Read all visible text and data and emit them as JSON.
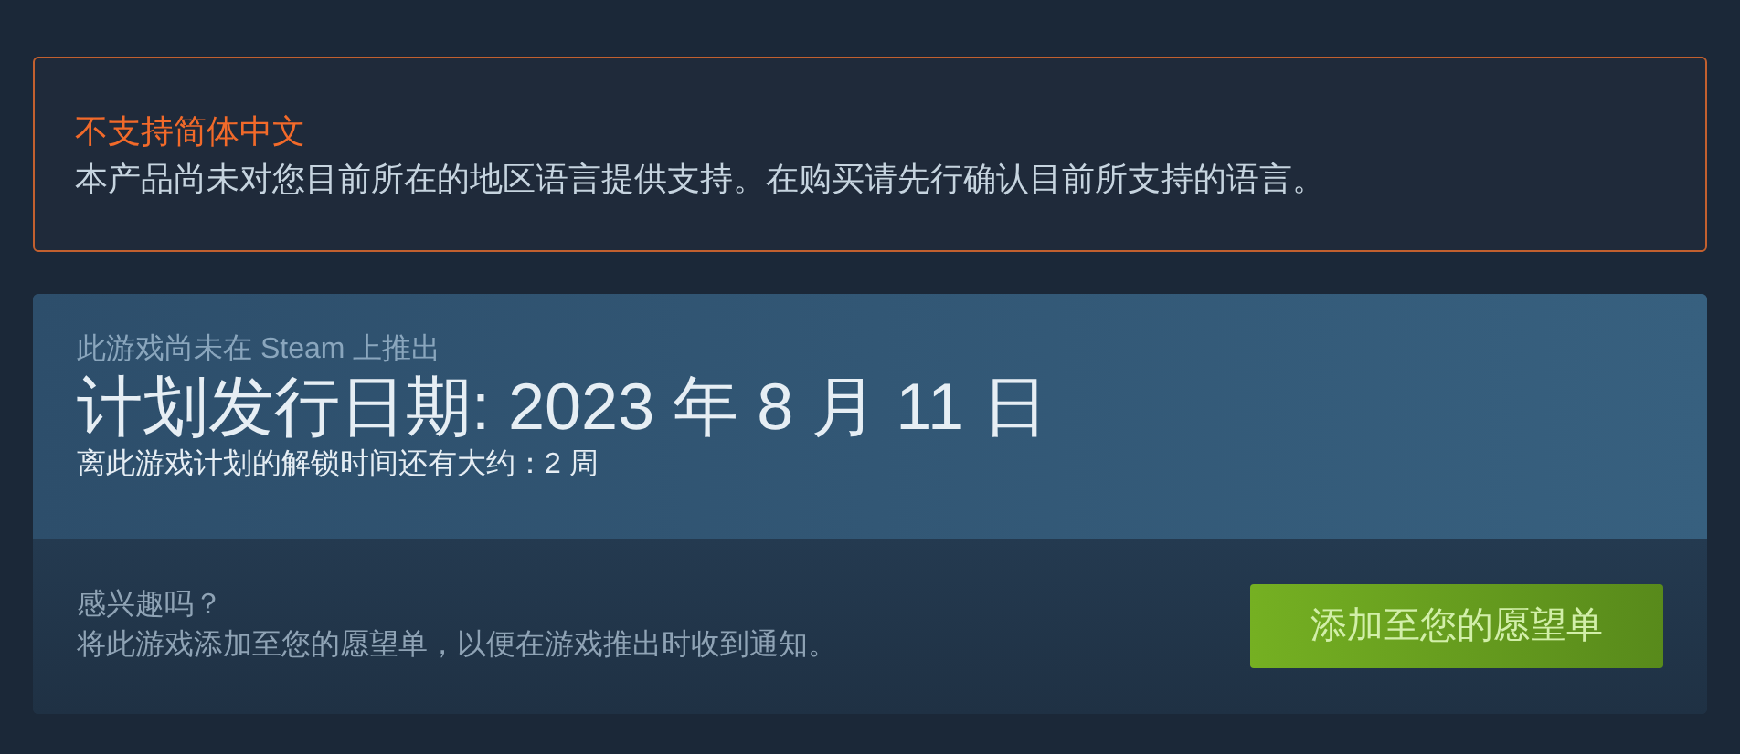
{
  "language_notice": {
    "title": "不支持简体中文",
    "message": "本产品尚未对您目前所在的地区语言提供支持。在购买请先行确认目前所支持的语言。"
  },
  "release": {
    "status": "此游戏尚未在 Steam 上推出",
    "date": "计划发行日期: 2023 年 8 月 11 日",
    "countdown": "离此游戏计划的解锁时间还有大约：2 周"
  },
  "wishlist": {
    "question": "感兴趣吗？",
    "description": "将此游戏添加至您的愿望单，以便在游戏推出时收到通知。",
    "button": "添加至您的愿望单"
  }
}
